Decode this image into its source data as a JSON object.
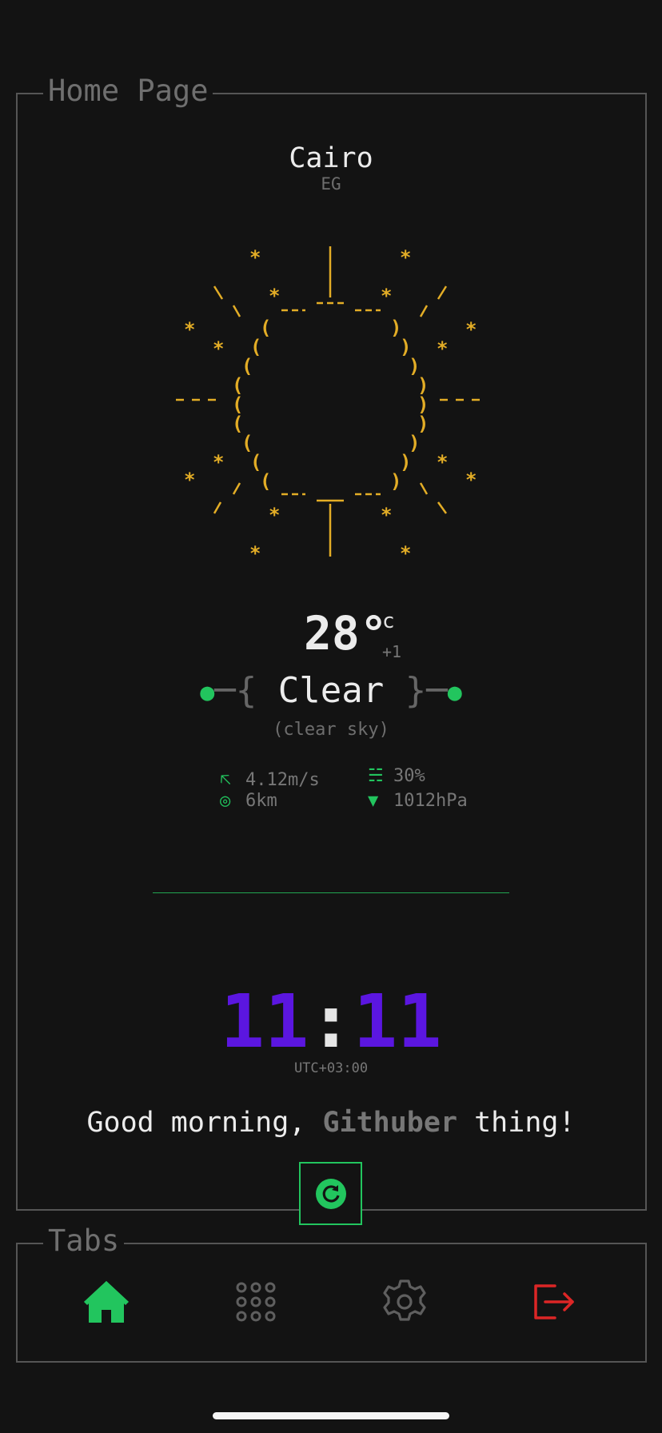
{
  "panels": {
    "home_title": "Home Page",
    "tabs_title": "Tabs"
  },
  "location": {
    "city": "Cairo",
    "country": "EG"
  },
  "weather": {
    "temperature": "28°",
    "unit": "c",
    "delta": "+1",
    "condition": "Clear",
    "description": "(clear sky)",
    "wind": "4.12m/s",
    "humidity": "30%",
    "visibility": "6km",
    "pressure": "1012hPa"
  },
  "clock": {
    "hours": "11",
    "separator": ":",
    "minutes": "11",
    "timezone": "UTC+03:00"
  },
  "greeting": {
    "prefix": "Good morning, ",
    "name": "Githuber",
    "suffix": " thing!"
  },
  "icons": {
    "wind": "wind-arrow-icon",
    "humidity": "humidity-lines-icon",
    "visibility": "eye-icon",
    "pressure": "pressure-down-icon",
    "refresh": "refresh-icon",
    "tabs": [
      "home-icon",
      "apps-grid-icon",
      "settings-icon",
      "logout-icon"
    ]
  },
  "colors": {
    "accent": "#22c55e",
    "sun": "#e3ad26",
    "clock": "#5b16e0",
    "logout": "#dc2626",
    "inactive": "#5f5f5f"
  }
}
